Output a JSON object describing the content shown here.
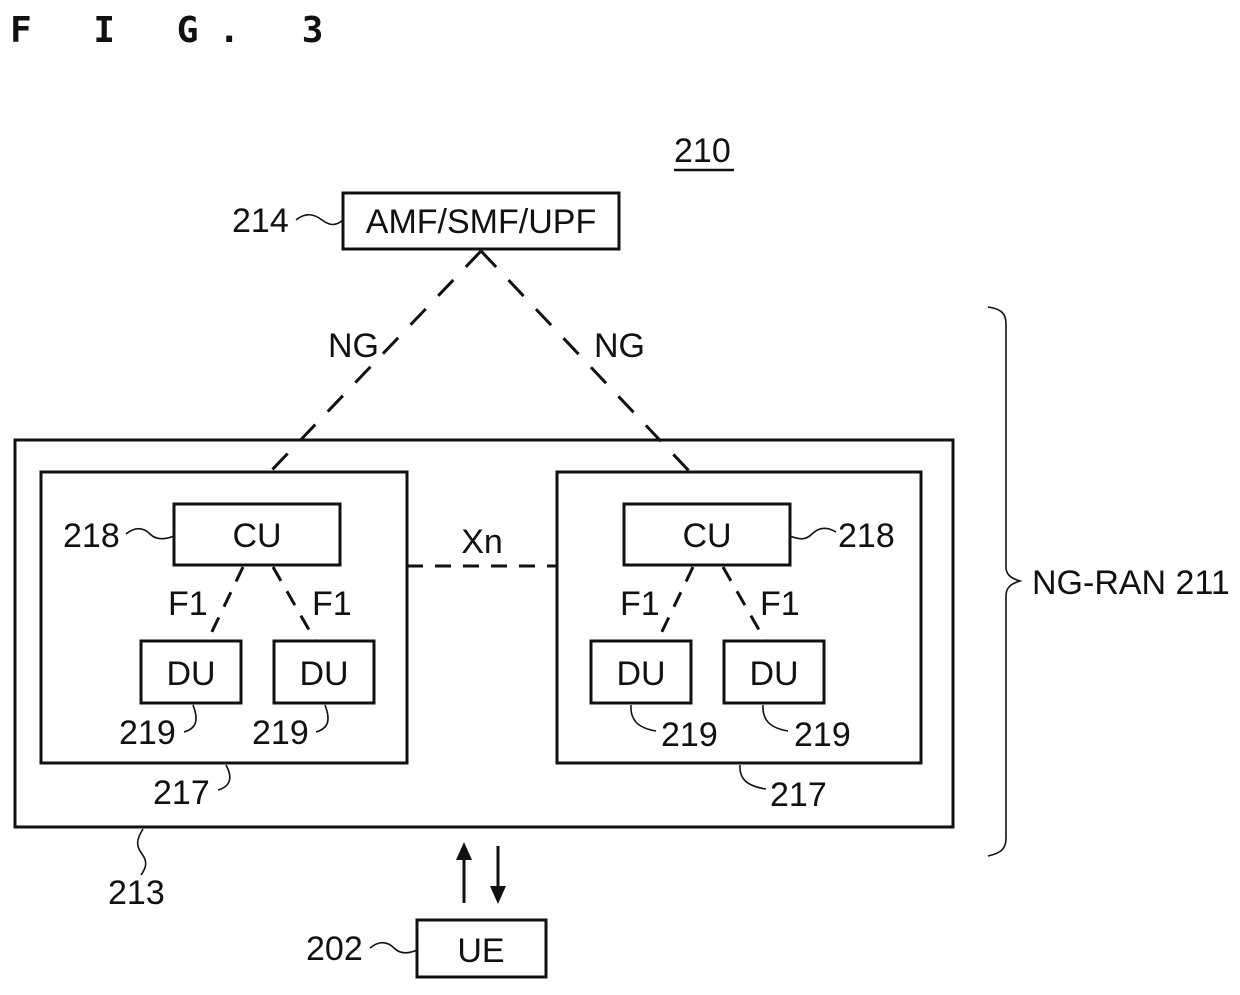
{
  "figure": {
    "title": "F I G. 3",
    "system_ref": "210"
  },
  "core": {
    "label": "AMF/SMF/UPF",
    "ref": "214"
  },
  "interfaces": {
    "ng_left": "NG",
    "ng_right": "NG",
    "xn": "Xn",
    "f1_labels": [
      "F1",
      "F1",
      "F1",
      "F1"
    ]
  },
  "ran": {
    "bracket_label": "NG-RAN 211",
    "outer_ref": "213",
    "gnbs": [
      {
        "ref": "217",
        "cu": {
          "label": "CU",
          "ref": "218"
        },
        "dus": [
          {
            "label": "DU",
            "ref": "219"
          },
          {
            "label": "DU",
            "ref": "219"
          }
        ]
      },
      {
        "ref": "217",
        "cu": {
          "label": "CU",
          "ref": "218"
        },
        "dus": [
          {
            "label": "DU",
            "ref": "219"
          },
          {
            "label": "DU",
            "ref": "219"
          }
        ]
      }
    ]
  },
  "ue": {
    "label": "UE",
    "ref": "202"
  }
}
